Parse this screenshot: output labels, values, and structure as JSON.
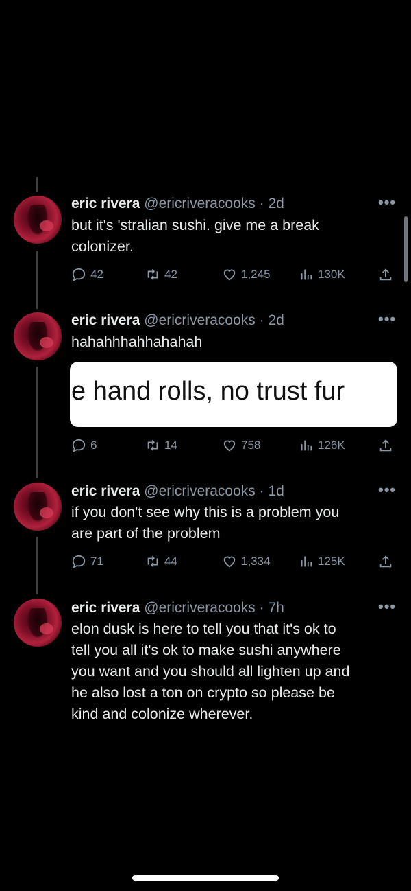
{
  "tweets": [
    {
      "name": "eric rivera",
      "handle": "@ericriveracooks",
      "time": "· 2d",
      "lines": [
        "but it's 'stralian sushi. give me a break",
        "colonizer."
      ],
      "replies": "42",
      "retweets": "42",
      "likes": "1,245",
      "views": "130K"
    },
    {
      "name": "eric rivera",
      "handle": "@ericriveracooks",
      "time": "· 2d",
      "lines": [
        "hahahhhahhahahah"
      ],
      "embed_text": "e hand rolls, no trust fur",
      "replies": "6",
      "retweets": "14",
      "likes": "758",
      "views": "126K"
    },
    {
      "name": "eric rivera",
      "handle": "@ericriveracooks",
      "time": "· 1d",
      "lines": [
        "if you don't see why this is a problem you",
        "are part of the problem"
      ],
      "replies": "71",
      "retweets": "44",
      "likes": "1,334",
      "views": "125K"
    },
    {
      "name": "eric rivera",
      "handle": "@ericriveracooks",
      "time": "· 7h",
      "lines": [
        "elon dusk is here to tell you that it's ok to",
        "tell you all it's ok to make sushi anywhere",
        "you want and you should all lighten up and",
        "he also lost a ton on crypto so please be",
        "kind and colonize wherever."
      ]
    }
  ],
  "icons": {
    "more": "more-dots-icon",
    "reply": "reply-icon",
    "retweet": "retweet-icon",
    "like": "heart-icon",
    "views": "views-icon",
    "share": "share-icon"
  },
  "colors": {
    "background": "#000000",
    "text": "#e7e9ea",
    "secondary": "#8b98a5",
    "thread_line": "#3e4144"
  }
}
